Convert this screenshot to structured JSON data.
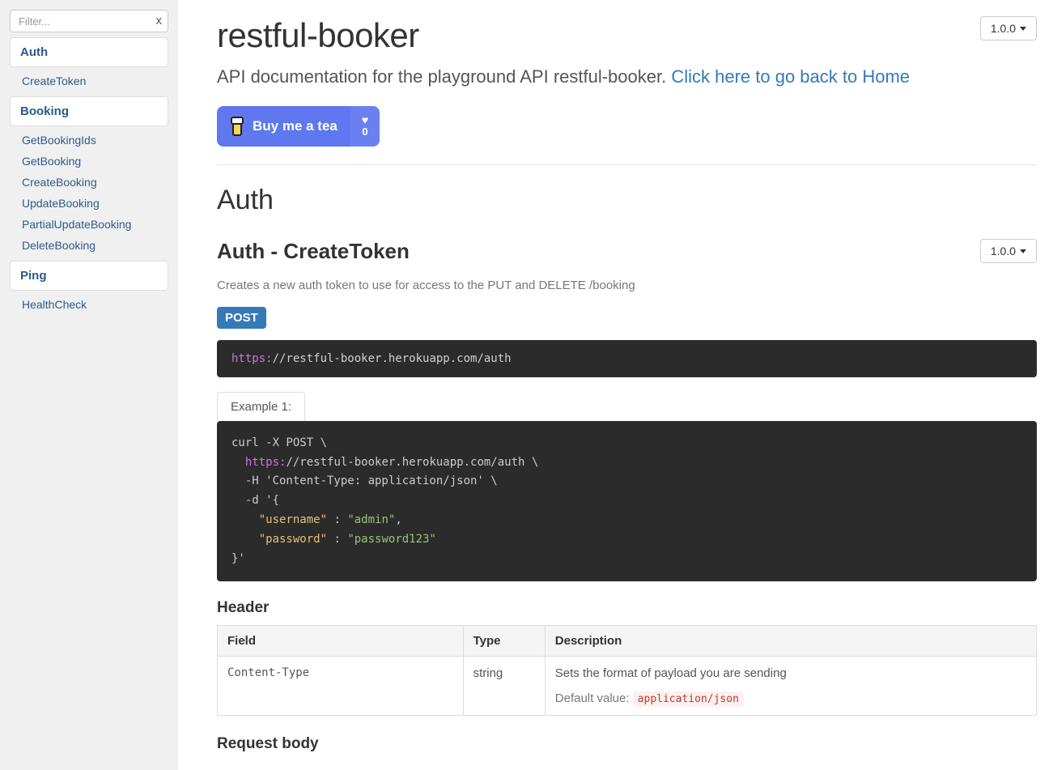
{
  "sidebar": {
    "filter_placeholder": "Filter...",
    "filter_clear": "x",
    "groups": [
      {
        "title": "Auth",
        "items": [
          "CreateToken"
        ]
      },
      {
        "title": "Booking",
        "items": [
          "GetBookingIds",
          "GetBooking",
          "CreateBooking",
          "UpdateBooking",
          "PartialUpdateBooking",
          "DeleteBooking"
        ]
      },
      {
        "title": "Ping",
        "items": [
          "HealthCheck"
        ]
      }
    ]
  },
  "header": {
    "title": "restful-booker",
    "version": "1.0.0",
    "subtitle_text": "API documentation for the playground API restful-booker. ",
    "subtitle_link": "Click here to go back to Home",
    "bmt": {
      "label": "Buy me a tea",
      "count": "0"
    }
  },
  "section": {
    "title": "Auth",
    "endpoint": {
      "title": "Auth - CreateToken",
      "version": "1.0.0",
      "description": "Creates a new auth token to use for access to the PUT and DELETE /booking",
      "method": "POST",
      "url_scheme": "https:",
      "url_rest": "//restful-booker.herokuapp.com/auth",
      "tab_label": "Example 1:",
      "curl": {
        "line1": "curl -X POST \\",
        "line2_scheme": "https:",
        "line2_rest": "//restful-booker.herokuapp.com/auth \\",
        "line3": "  -H 'Content-Type: application/json' \\",
        "line4": "  -d '{",
        "key1": "\"username\"",
        "val1": "\"admin\"",
        "key2": "\"password\"",
        "val2": "\"password123\"",
        "line7": "}'"
      },
      "header_section": {
        "title": "Header",
        "columns": [
          "Field",
          "Type",
          "Description"
        ],
        "row": {
          "field": "Content-Type",
          "type": "string",
          "desc": "Sets the format of payload you are sending",
          "default_label": "Default value: ",
          "default_value": "application/json"
        }
      },
      "request_body_title": "Request body"
    }
  }
}
